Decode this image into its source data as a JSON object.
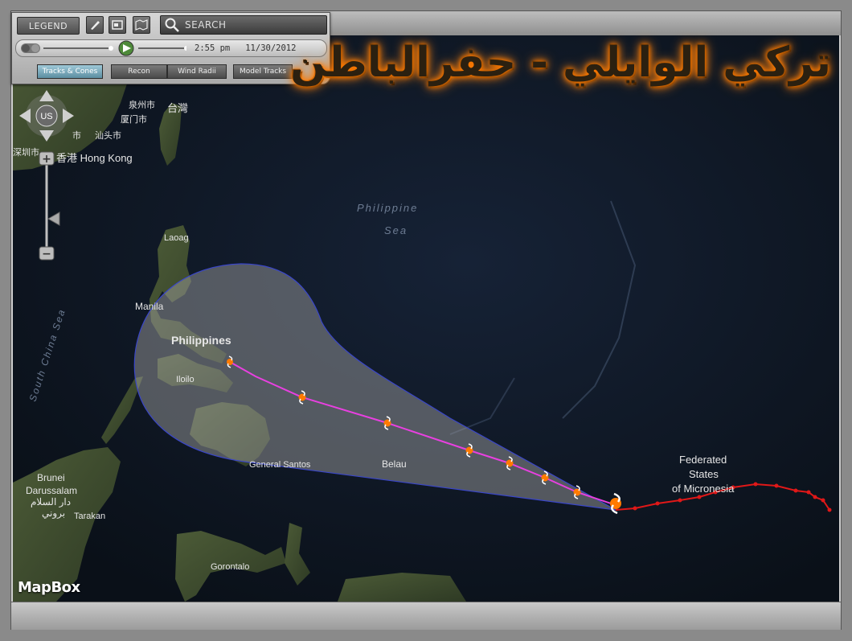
{
  "title_overlay": "تركي الوايلي - حفرالباطن",
  "toolbar": {
    "legend_label": "LEGEND",
    "search_placeholder": "SEARCH",
    "time": "2:55 pm",
    "date": "11/30/2012",
    "tabs": [
      {
        "label": "Tracks & Cones",
        "active": true
      },
      {
        "label": "Recon",
        "active": false
      },
      {
        "label": "Wind Radii",
        "active": false
      },
      {
        "label": "Model Tracks",
        "active": false
      }
    ]
  },
  "nav": {
    "region_label": "US",
    "zoom_in": "+",
    "zoom_out": "−"
  },
  "attribution": "MapBox",
  "map_labels": {
    "taiwan": "台灣",
    "quanzhou": "泉州市",
    "xiamen": "厦门市",
    "shantou": "汕头市",
    "shenzhen": "深圳市",
    "guangzhou_frag": "市",
    "hongkong": "香港 Hong Kong",
    "philippine_sea_1": "Philippine",
    "philippine_sea_2": "Sea",
    "laoag": "Laoag",
    "manila": "Manila",
    "philippines": "Philippines",
    "iloilo": "Iloilo",
    "general_santos": "General Santos",
    "belau": "Belau",
    "micronesia_1": "Federated",
    "micronesia_2": "States",
    "micronesia_3": "of Micronesia",
    "brunei_1": "Brunei",
    "brunei_2": "Darussalam",
    "brunei_3": "دار السلام",
    "brunei_4": "بروني",
    "tarakan": "Tarakan",
    "gorontalo": "Gorontalo",
    "scs": "South China Sea"
  },
  "colors": {
    "ocean": "#0f1826",
    "land": "#3b4a2e",
    "cone_fill": "#9a9a9a",
    "forecast_track": "#e840e0",
    "past_track": "#e01818",
    "storm_icon": "#ff7a00"
  }
}
